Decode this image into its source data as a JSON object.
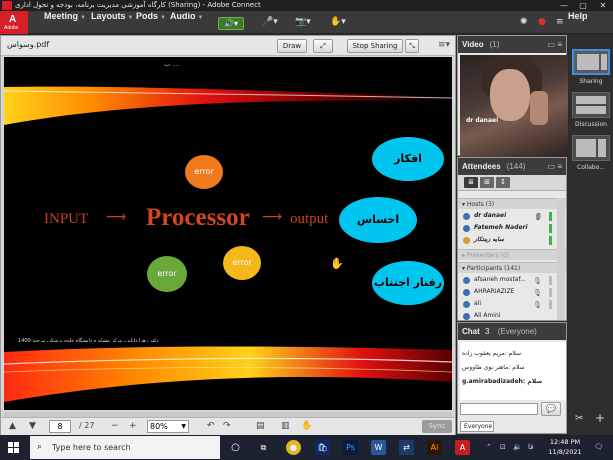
{
  "window": {
    "title": "کارگاه آموزشی مدیریت برنامه، بودجه و تحول اداری (Sharing) - Adobe Connect",
    "minimize": "—",
    "maximize": "▢",
    "close": "✕"
  },
  "app_logo": {
    "letter": "A",
    "text": "Adobe"
  },
  "menubar": {
    "items": [
      "Meeting",
      "Layouts",
      "Pods",
      "Audio"
    ],
    "help": "Help"
  },
  "share_pod": {
    "filename": "وسواس.pdf",
    "draw_label": "Draw",
    "stop_sharing_label": "Stop Sharing"
  },
  "slide": {
    "top_text": "ب  ...",
    "input": "INPUT",
    "processor": "Processor",
    "output": "output",
    "bubbles": [
      "error",
      "error",
      "error"
    ],
    "cyan_labels": [
      "افکار ترسناک",
      "احساس اضطراب",
      "رفتار اجتناب"
    ],
    "footer_note": "دکتر زهرا دانایی، مرکز مشاوره دانشگاه علوم پزشکی بیرجند-1400"
  },
  "share_toolbar": {
    "page": "8",
    "total": "/ 27",
    "zoom": "80%",
    "sync": "Sync"
  },
  "video_pod": {
    "title": "Video",
    "count": "(1)",
    "presenter_name": "dr danaei"
  },
  "attendees_pod": {
    "title": "Attendees",
    "count": "(144)",
    "hosts_label": "Hosts (3)",
    "hosts": [
      "dr danaei",
      "Fatemeh Naderi",
      "سایه زینتکار"
    ],
    "presenters_label": "Presenters (0)",
    "participants_label": "Participants (141)",
    "participants": [
      "afsaneh mostaf...",
      "AHRARIAZIZE",
      "ali",
      "Ali Amini"
    ]
  },
  "chat_pod": {
    "title": "Chat",
    "number": "3",
    "scope": "(Everyone)",
    "messages": [
      "سلام :مریم یعقوب زاده",
      "سلام :ماهتر بوی طاووس",
      "g.amirabadizadeh: سلام"
    ],
    "tab": "Everyone"
  },
  "layouts": [
    "Sharing",
    "Discussion",
    "Collabo..."
  ],
  "taskbar": {
    "search_placeholder": "Type here to search",
    "lang": "فا",
    "time": "12:48 PM",
    "date": "11/8/2021"
  },
  "colors": {
    "adobe_red": "#d61f26",
    "slide_text": "#c8421a",
    "cyan_bubble": "#00c6ef",
    "speaker_green": "#3c7a2a"
  }
}
